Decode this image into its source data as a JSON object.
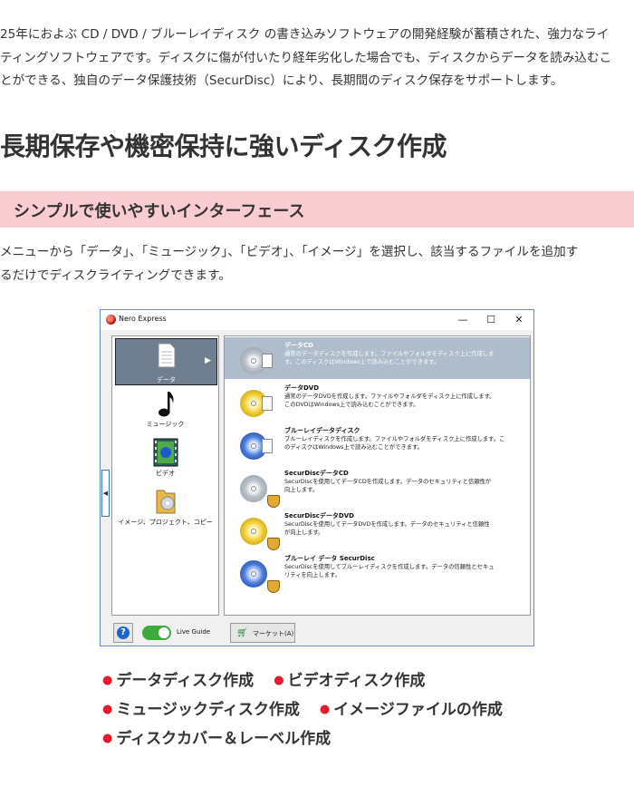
{
  "intro": "25年におよぶ CD / DVD / ブルーレイディスク の書き込みソフトウェアの開発経験が蓄積された、強力なライ\nティングソフトウェアです。ディスクに傷が付いたり経年劣化した場合でも、ディスクからデータを読み込むこ\nとができる、独自のデータ保護技術（SecurDisc）により、長期間のディスク保存をサポートします。",
  "section_title": "長期保存や機密保持に強いディスク作成",
  "subsection_title": "シンプルで使いやすいインターフェース",
  "description": "メニューから「データ」、「ミュージック」、「ビデオ」、「イメージ」を選択し、該当するファイルを追加す\nるだけでディスクライティングできます。",
  "window": {
    "title": "Nero Express",
    "minimize": "—",
    "maximize": "☐",
    "close": "✕",
    "categories": [
      {
        "label": "データ",
        "icon": "data-document-icon"
      },
      {
        "label": "ミュージック",
        "icon": "music-note-icon"
      },
      {
        "label": "ビデオ",
        "icon": "film-icon"
      },
      {
        "label": "イメージ、プロジェクト、コピー",
        "icon": "folder-icon"
      }
    ],
    "tasks": [
      {
        "title": "データCD",
        "desc": "通常のデータディスクを作成します。ファイルやフォルダをディスク上に作成しま\nす。このディスクはWindows上で読み込むことができます。"
      },
      {
        "title": "データDVD",
        "desc": "通常のデータDVDを作成します。ファイルやフォルダをディスク上に作成します。\nこのDVDはWindows上で読み込むことができます。"
      },
      {
        "title": "ブルーレイデータディスク",
        "desc": "ブルーレイディスクを作成します。ファイルやフォルダをディスク上に作成します。こ\nのディスクはWindows上で読み込むことができます。"
      },
      {
        "title": "SecurDiscデータCD",
        "desc": "SecurDiscを使用してデータCDを作成します。データのセキュリティと信頼性が\n向上します。"
      },
      {
        "title": "SecurDiscデータDVD",
        "desc": "SecurDiscを使用してデータDVDを作成します。データのセキュリティと信頼性\nが向上します。"
      },
      {
        "title": "ブルーレイ データ SecurDisc",
        "desc": "SecurDiscを使用してブルーレイディスクを作成します。データの信頼性とセキュ\nリティを向上します。"
      }
    ],
    "help": "?",
    "live_guide": "Live Guide",
    "market": "マーケット(A)"
  },
  "features": [
    [
      "データディスク作成",
      "ビデオディスク作成"
    ],
    [
      "ミュージックディスク作成",
      "イメージファイルの作成"
    ],
    [
      "ディスクカバー＆レーベル作成"
    ]
  ],
  "colors": {
    "band": "#f8ccd1",
    "bullet": "#e51a2e",
    "selected_task": "#aebccb"
  }
}
